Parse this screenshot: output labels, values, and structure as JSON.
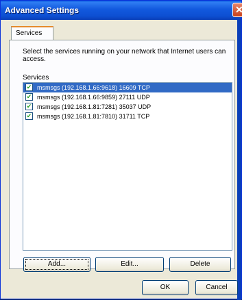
{
  "window": {
    "title": "Advanced Settings",
    "close_glyph": "✕"
  },
  "tabs": [
    {
      "label": "Services"
    }
  ],
  "panel": {
    "description": "Select the services running on your network that Internet users can access.",
    "services_label": "Services"
  },
  "services": [
    {
      "checked": true,
      "label": "msmsgs (192.168.1.66:9618) 16609 TCP",
      "selected": true
    },
    {
      "checked": true,
      "label": "msmsgs (192.168.1.66:9859) 27111 UDP",
      "selected": false
    },
    {
      "checked": true,
      "label": "msmsgs (192.168.1.81:7281) 35037 UDP",
      "selected": false
    },
    {
      "checked": true,
      "label": "msmsgs (192.168.1.81:7810) 31711 TCP",
      "selected": false
    }
  ],
  "buttons": {
    "add": "Add...",
    "edit": "Edit...",
    "delete": "Delete",
    "ok": "OK",
    "cancel": "Cancel"
  },
  "colors": {
    "titlebar": "#0a5ce0",
    "selection": "#316ac5",
    "tab_accent": "#e68b2c"
  },
  "check_glyph": "✔"
}
